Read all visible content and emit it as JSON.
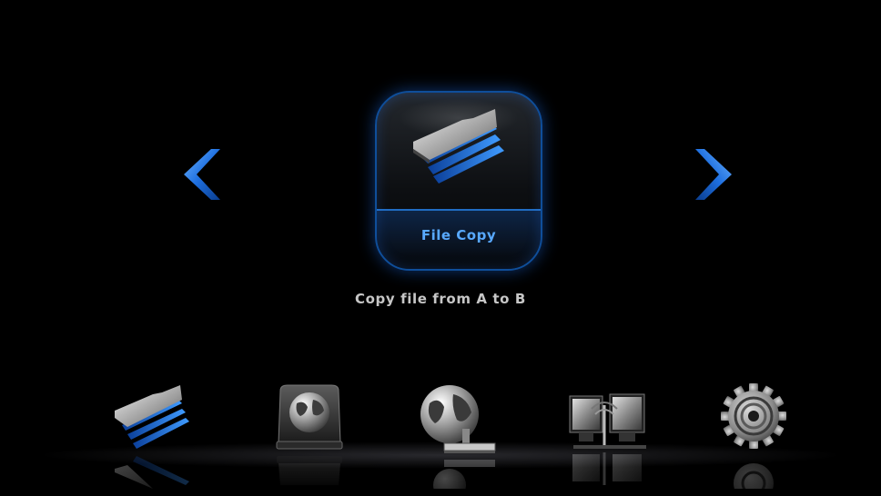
{
  "carousel": {
    "selected_title": "File Copy",
    "selected_description": "Copy file from A to B",
    "prev_icon": "chevron-left-icon",
    "next_icon": "chevron-right-icon"
  },
  "dock": {
    "items": [
      {
        "name": "file-copy",
        "icon": "file-copy-icon"
      },
      {
        "name": "network-drive",
        "icon": "globe-drive-icon"
      },
      {
        "name": "network",
        "icon": "globe-network-icon"
      },
      {
        "name": "wireless-display",
        "icon": "monitors-antenna-icon"
      },
      {
        "name": "settings",
        "icon": "gear-icon"
      }
    ]
  },
  "colors": {
    "accent": "#1e6fe0",
    "title_text": "#58a9ff",
    "description_text": "#c7c7c7",
    "background": "#000000"
  }
}
